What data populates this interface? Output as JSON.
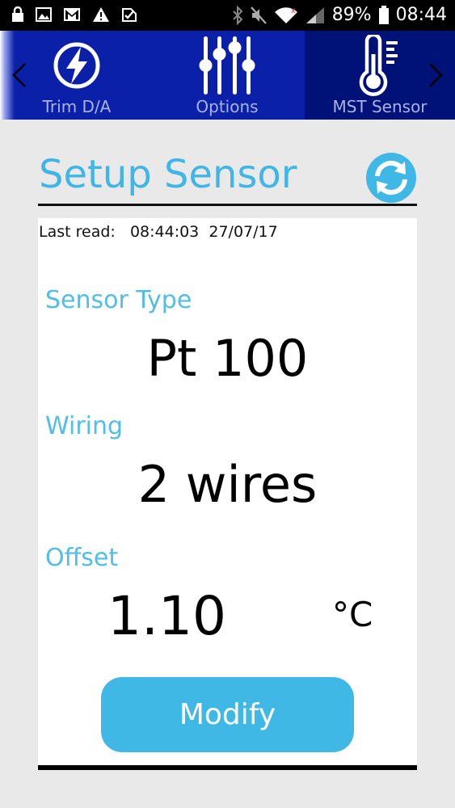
{
  "status_bar": {
    "battery": "89%",
    "time": "08:44"
  },
  "nav": {
    "items": [
      {
        "label": "Trim D/A",
        "icon": "lightning-icon"
      },
      {
        "label": "Options",
        "icon": "sliders-icon"
      },
      {
        "label": "MST Sensor",
        "icon": "thermometer-icon",
        "active": true
      }
    ],
    "bar_color": "#0a20a8",
    "active_color": "#001178"
  },
  "page": {
    "title": "Setup Sensor",
    "last_read_label": "Last read:",
    "last_read_time": "08:44:03",
    "last_read_date": "27/07/17"
  },
  "sensor": {
    "type_label": "Sensor Type",
    "type_value": "Pt 100",
    "wiring_label": "Wiring",
    "wiring_value": "2 wires",
    "offset_label": "Offset",
    "offset_value": "1.10",
    "offset_unit": "°C"
  },
  "actions": {
    "modify_label": "Modify"
  },
  "colors": {
    "accent": "#3fb8e6",
    "label": "#52bde8"
  }
}
